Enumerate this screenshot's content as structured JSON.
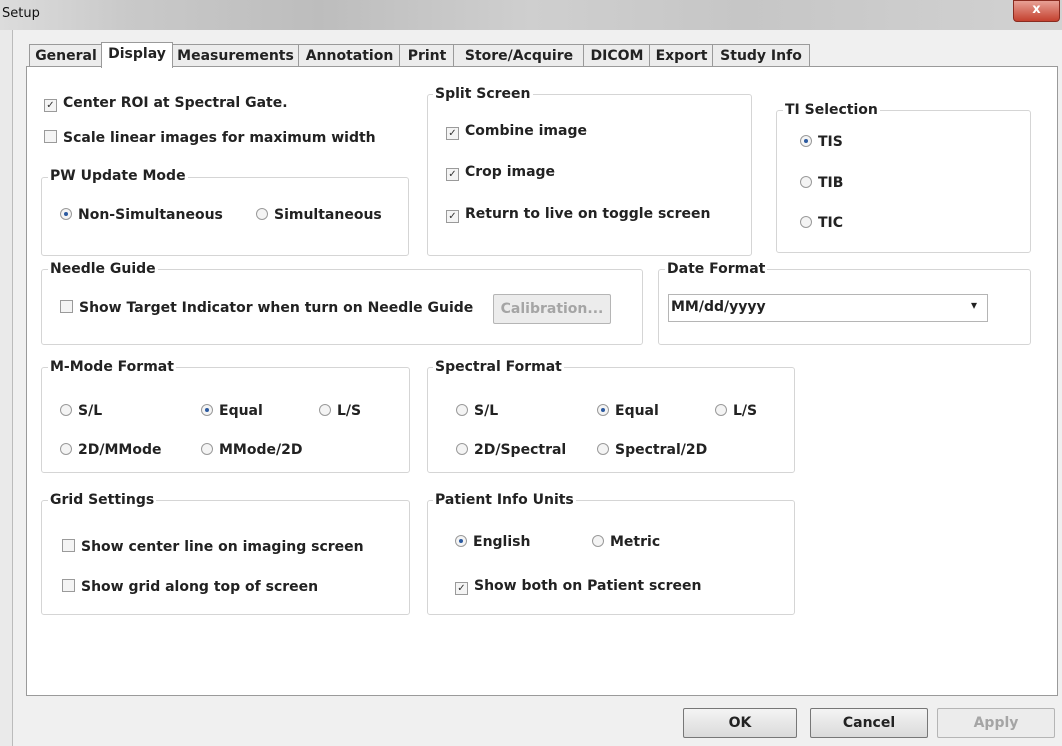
{
  "window": {
    "title": "Setup",
    "close_glyph": "x"
  },
  "tabs": [
    "General",
    "Display",
    "Measurements",
    "Annotation",
    "Print",
    "Store/Acquire",
    "DICOM",
    "Export",
    "Study Info"
  ],
  "active_tab": "Display",
  "display": {
    "center_roi": {
      "label": "Center ROI at Spectral Gate.",
      "checked": true
    },
    "scale_linear": {
      "label": "Scale linear images for maximum width",
      "checked": false
    },
    "pw_update_mode": {
      "title": "PW Update Mode",
      "options": [
        "Non-Simultaneous",
        "Simultaneous"
      ],
      "selected": "Non-Simultaneous"
    },
    "split_screen": {
      "title": "Split Screen",
      "combine": {
        "label": "Combine image",
        "checked": true
      },
      "crop": {
        "label": "Crop image",
        "checked": true
      },
      "return_live": {
        "label": "Return to live on toggle screen",
        "checked": true
      }
    },
    "ti_selection": {
      "title": "TI Selection",
      "options": [
        "TIS",
        "TIB",
        "TIC"
      ],
      "selected": "TIS"
    },
    "needle_guide": {
      "title": "Needle Guide",
      "show_target": {
        "label": "Show Target Indicator when turn on Needle Guide",
        "checked": false
      },
      "calibration_label": "Calibration..."
    },
    "date_format": {
      "title": "Date Format",
      "value": "MM/dd/yyyy",
      "arrow": "▾"
    },
    "m_mode_format": {
      "title": "M-Mode Format",
      "options": [
        "S/L",
        "Equal",
        "L/S",
        "2D/MMode",
        "MMode/2D"
      ],
      "selected": "Equal"
    },
    "spectral_format": {
      "title": "Spectral Format",
      "options": [
        "S/L",
        "Equal",
        "L/S",
        "2D/Spectral",
        "Spectral/2D"
      ],
      "selected": "Equal"
    },
    "grid_settings": {
      "title": "Grid Settings",
      "center_line": {
        "label": "Show center line on imaging screen",
        "checked": false
      },
      "grid_top": {
        "label": "Show grid along top of screen",
        "checked": false
      }
    },
    "patient_info_units": {
      "title": "Patient Info Units",
      "options": [
        "English",
        "Metric"
      ],
      "selected": "English",
      "show_both": {
        "label": "Show both on Patient screen",
        "checked": true
      }
    }
  },
  "footer": {
    "ok_label": "OK",
    "cancel_label": "Cancel",
    "apply_label": "Apply"
  }
}
